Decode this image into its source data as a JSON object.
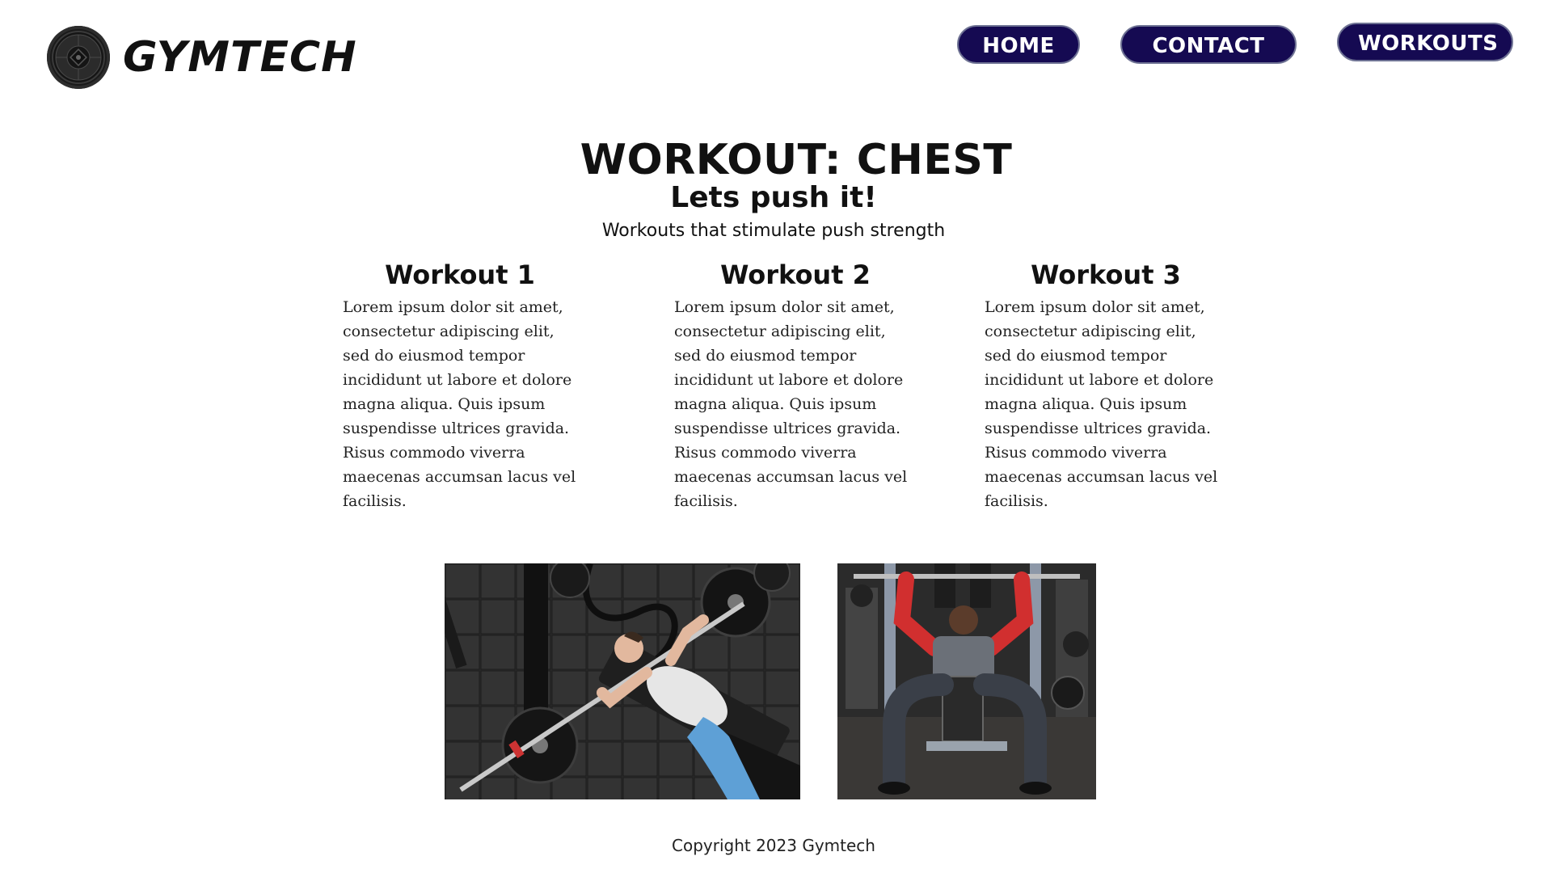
{
  "brand": {
    "name": "GYMTECH"
  },
  "nav": {
    "items": [
      {
        "label": "HOME"
      },
      {
        "label": "CONTACT"
      },
      {
        "label": "WORKOUTS"
      }
    ]
  },
  "hero": {
    "title": "WORKOUT: CHEST",
    "subtitle": "Lets push it!",
    "description": "Workouts that stimulate push strength"
  },
  "workouts": [
    {
      "title": "Workout 1",
      "body": "Lorem ipsum dolor sit amet, consectetur adipiscing elit, sed do eiusmod tempor incididunt ut labore et dolore magna aliqua. Quis ipsum suspendisse ultrices gravida. Risus commodo viverra maecenas accumsan lacus vel facilisis."
    },
    {
      "title": "Workout 2",
      "body": "Lorem ipsum dolor sit amet, consectetur adipiscing elit, sed do eiusmod tempor incididunt ut labore et dolore magna aliqua. Quis ipsum suspendisse ultrices gravida. Risus commodo viverra maecenas accumsan lacus vel facilisis."
    },
    {
      "title": "Workout 3",
      "body": "Lorem ipsum dolor sit amet, consectetur adipiscing elit, sed do eiusmod tempor incididunt ut labore et dolore magna aliqua. Quis ipsum suspendisse ultrices gravida. Risus commodo viverra maecenas accumsan lacus vel facilisis."
    }
  ],
  "photos": [
    {
      "subject": "bench-press-photo"
    },
    {
      "subject": "incline-bench-press-photo"
    }
  ],
  "footer": {
    "copyright": "Copyright 2023 Gymtech"
  },
  "colors": {
    "nav_bg": "#150a52",
    "nav_text": "#ffffff",
    "text": "#111111"
  }
}
